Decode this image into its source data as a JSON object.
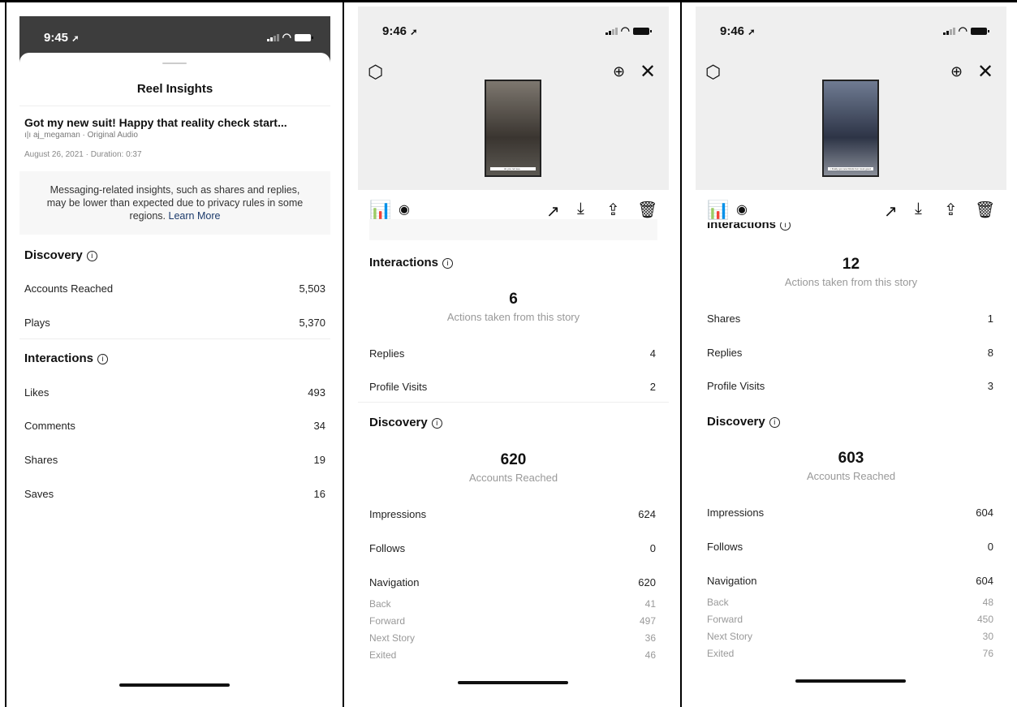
{
  "panel1": {
    "time": "9:45",
    "header_title": "Reel Insights",
    "reel_title": "Got my new suit! Happy that reality check start...",
    "audio": "aj_megaman · Original Audio",
    "meta": "August 26, 2021 · Duration: 0:37",
    "notice_text": "Messaging-related insights, such as shares and replies, may be lower than expected due to privacy rules in some regions.",
    "notice_link": "Learn More",
    "discovery_title": "Discovery",
    "discovery_rows": [
      {
        "label": "Accounts Reached",
        "value": "5,503"
      },
      {
        "label": "Plays",
        "value": "5,370"
      }
    ],
    "interactions_title": "Interactions",
    "interaction_rows": [
      {
        "label": "Likes",
        "value": "493"
      },
      {
        "label": "Comments",
        "value": "34"
      },
      {
        "label": "Shares",
        "value": "19"
      },
      {
        "label": "Saves",
        "value": "16"
      }
    ]
  },
  "panel2": {
    "time": "9:46",
    "thumb_caption": "do you not see...",
    "interactions_title": "Interactions",
    "actions_count": "6",
    "actions_label": "Actions taken from this story",
    "interaction_rows": [
      {
        "label": "Replies",
        "value": "4"
      },
      {
        "label": "Profile Visits",
        "value": "2"
      }
    ],
    "discovery_title": "Discovery",
    "reached_count": "620",
    "reached_label": "Accounts Reached",
    "discovery_rows": [
      {
        "label": "Impressions",
        "value": "624"
      },
      {
        "label": "Follows",
        "value": "0"
      },
      {
        "label": "Navigation",
        "value": "620"
      }
    ],
    "navigation_rows": [
      {
        "label": "Back",
        "value": "41"
      },
      {
        "label": "Forward",
        "value": "497"
      },
      {
        "label": "Next Story",
        "value": "36"
      },
      {
        "label": "Exited",
        "value": "46"
      }
    ]
  },
  "panel3": {
    "time": "9:46",
    "thumb_caption": "i finally got new blinds but i look good",
    "interactions_title": "Interactions",
    "actions_count": "12",
    "actions_label": "Actions taken from this story",
    "interaction_rows": [
      {
        "label": "Shares",
        "value": "1"
      },
      {
        "label": "Replies",
        "value": "8"
      },
      {
        "label": "Profile Visits",
        "value": "3"
      }
    ],
    "discovery_title": "Discovery",
    "reached_count": "603",
    "reached_label": "Accounts Reached",
    "discovery_rows": [
      {
        "label": "Impressions",
        "value": "604"
      },
      {
        "label": "Follows",
        "value": "0"
      },
      {
        "label": "Navigation",
        "value": "604"
      }
    ],
    "navigation_rows": [
      {
        "label": "Back",
        "value": "48"
      },
      {
        "label": "Forward",
        "value": "450"
      },
      {
        "label": "Next Story",
        "value": "30"
      },
      {
        "label": "Exited",
        "value": "76"
      }
    ]
  },
  "colors": {
    "accent_blue": "#3897f0",
    "link_blue": "#1b3a6b"
  },
  "icons": [
    "location-arrow-icon",
    "signal-icon",
    "wifi-icon",
    "battery-icon",
    "settings-icon",
    "download-circle-icon",
    "close-icon",
    "bar-chart-icon",
    "eye-icon",
    "trend-icon",
    "download-icon",
    "share-icon",
    "trash-icon",
    "info-icon"
  ]
}
